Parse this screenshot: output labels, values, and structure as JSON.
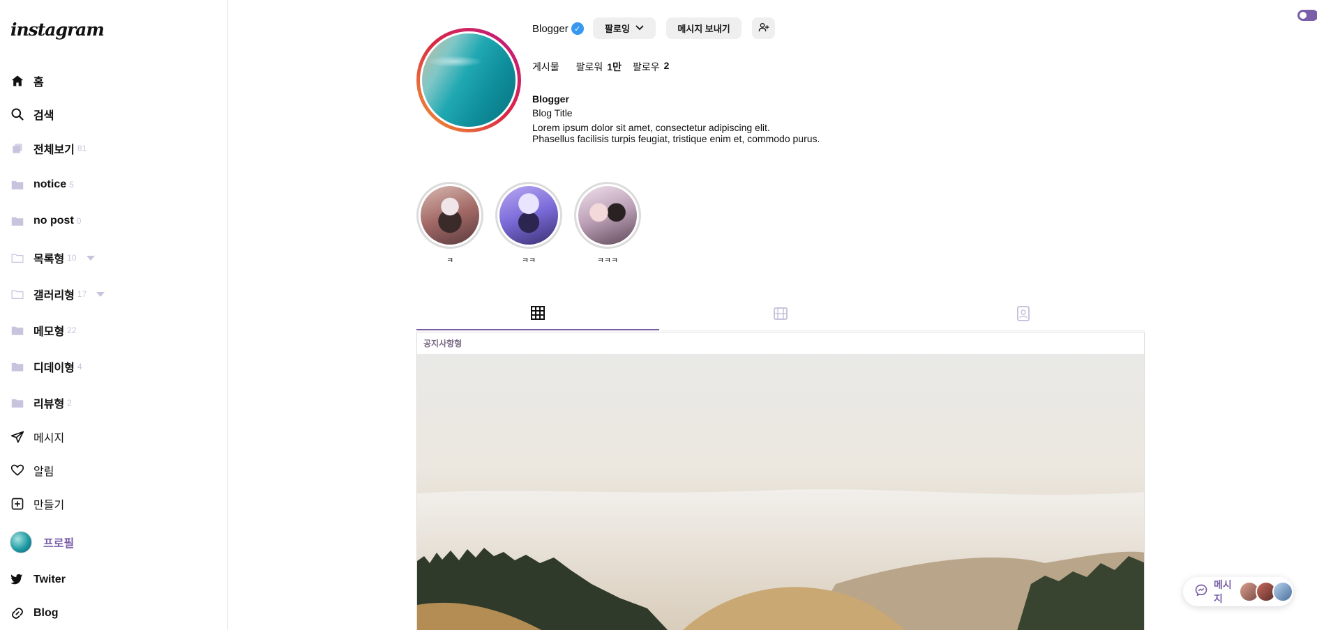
{
  "sidebar": {
    "logo": "instagram",
    "nav": [
      {
        "label": "홈",
        "icon": "home-icon"
      },
      {
        "label": "검색",
        "icon": "search-icon"
      }
    ],
    "categories": [
      {
        "label": "전체보기",
        "count": "81",
        "icon": "stack-icon"
      },
      {
        "label": "notice",
        "count": "5",
        "icon": "folder-icon"
      },
      {
        "label": "no post",
        "count": "0",
        "icon": "folder-icon"
      },
      {
        "label": "목록형",
        "count": "10",
        "icon": "folder-outline-icon",
        "expandable": true
      },
      {
        "label": "갤러리형",
        "count": "17",
        "icon": "folder-outline-icon",
        "expandable": true
      },
      {
        "label": "메모형",
        "count": "22",
        "icon": "folder-icon"
      },
      {
        "label": "디데이형",
        "count": "4",
        "icon": "folder-icon"
      },
      {
        "label": "리뷰형",
        "count": "2",
        "icon": "folder-icon"
      }
    ],
    "actions": [
      {
        "label": "메시지",
        "icon": "send-icon"
      },
      {
        "label": "알림",
        "icon": "heart-icon"
      },
      {
        "label": "만들기",
        "icon": "plus-square-icon"
      }
    ],
    "profile_label": "프로필",
    "links": [
      {
        "label": "Twiter",
        "icon": "twitter-icon"
      },
      {
        "label": "Blog",
        "icon": "link-icon"
      }
    ]
  },
  "profile": {
    "username": "Blogger",
    "follow_button": "팔로잉",
    "message_button": "메시지 보내기",
    "stats": {
      "posts_label": "게시물",
      "followers_label": "팔로워",
      "followers_value": "1만",
      "following_label": "팔로우",
      "following_value": "2"
    },
    "bio_name": "Blogger",
    "bio_title": "Blog Title",
    "bio_line1": "Lorem ipsum dolor sit amet, consectetur adipiscing elit.",
    "bio_line2": "Phasellus facilisis turpis feugiat, tristique enim et, commodo purus."
  },
  "highlights": [
    {
      "label": "ㅋ"
    },
    {
      "label": "ㅋㅋ"
    },
    {
      "label": "ㅋㅋㅋ"
    }
  ],
  "tabs": [
    {
      "icon": "grid-icon",
      "active": true
    },
    {
      "icon": "film-icon",
      "active": false
    },
    {
      "icon": "tagged-icon",
      "active": false
    }
  ],
  "post": {
    "category": "공지사항형"
  },
  "message_pill": {
    "label": "메시지"
  },
  "colors": {
    "accent": "#7a5fa8",
    "folder": "#c9c4dd",
    "verified": "#3897f0"
  }
}
